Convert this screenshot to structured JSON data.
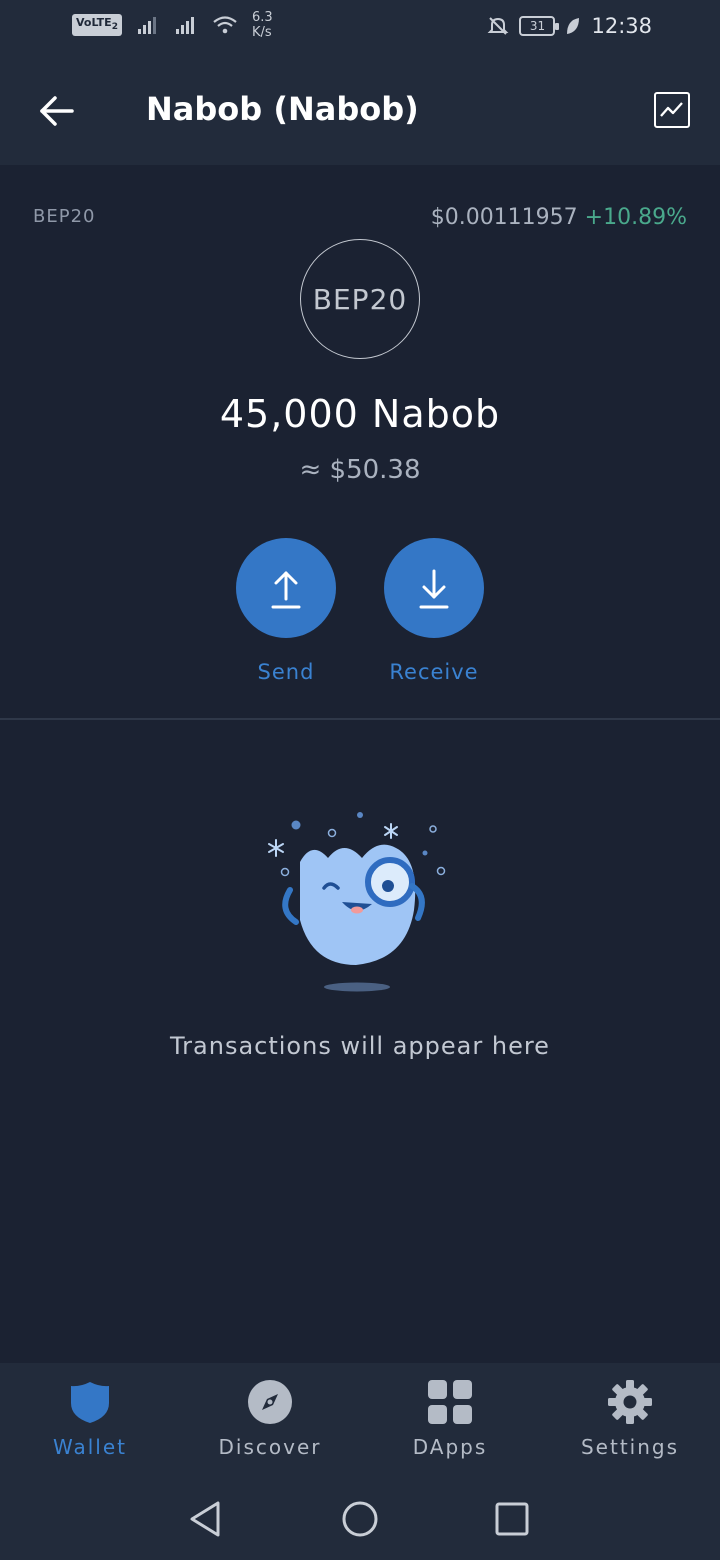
{
  "status_bar": {
    "volte_label": "VoLTE",
    "volte_sim": "2",
    "net_speed_value": "6.3",
    "net_speed_unit": "K/s",
    "battery_level": "31",
    "time": "12:38"
  },
  "header": {
    "title": "Nabob (Nabob)",
    "back_icon": "arrow-left-icon",
    "chart_icon": "line-chart-icon"
  },
  "token": {
    "network": "BEP20",
    "price": "$0.00111957",
    "price_change": "+10.89%",
    "logo_text": "BEP20",
    "balance": "45,000 Nabob",
    "fiat_value": "≈ $50.38"
  },
  "actions": {
    "send_label": "Send",
    "receive_label": "Receive"
  },
  "empty_state": {
    "message": "Transactions will appear here"
  },
  "bottom_nav": {
    "items": [
      {
        "label": "Wallet",
        "icon": "shield-icon",
        "active": true
      },
      {
        "label": "Discover",
        "icon": "compass-icon",
        "active": false
      },
      {
        "label": "DApps",
        "icon": "grid-icon",
        "active": false
      },
      {
        "label": "Settings",
        "icon": "gear-icon",
        "active": false
      }
    ]
  },
  "colors": {
    "background": "#1b2232",
    "header": "#222b3b",
    "accent": "#3477c6",
    "positive": "#4aa98c"
  }
}
